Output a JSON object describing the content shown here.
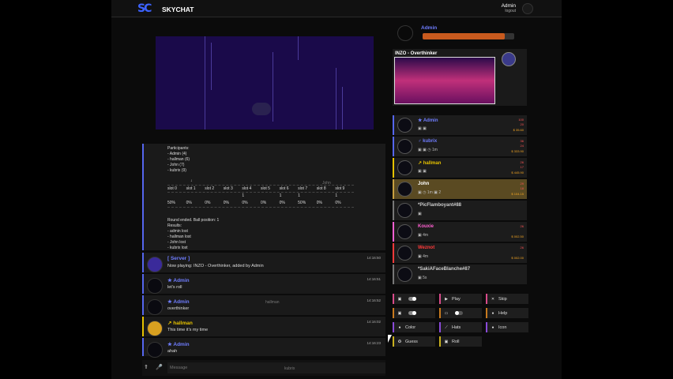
{
  "app": {
    "brand": "SKYCHAT",
    "logo": "SC"
  },
  "header": {
    "username": "Admin",
    "logout": "logout"
  },
  "sidebar_user": {
    "name": "Admin",
    "progress": 0.9
  },
  "now_playing": {
    "title": "INZO - Overthinker"
  },
  "participants": {
    "header": "Participants:",
    "list": [
      "- Admin (4)",
      "- hallman (6)",
      "- John (7)",
      "- kubrix (9)"
    ],
    "arrow": "↓",
    "slot_labels": [
      "slot 0",
      "slot 1",
      "slot 2",
      "slot 3",
      "slot 4",
      "slot 5",
      "slot 6",
      "slot 7",
      "slot 8",
      "slot 9"
    ],
    "slot_markers": [
      "",
      "",
      "",
      "",
      "1",
      "",
      "1",
      "1",
      "",
      "1"
    ],
    "slot_percents": [
      "50%",
      "0%",
      "0%",
      "0%",
      "0%",
      "0%",
      "0%",
      "50%",
      "0%",
      "0%"
    ],
    "round_result": "Round ended. Ball position: 1",
    "results_label": "Results:",
    "results": [
      "- admin lost",
      "- hallman lost",
      "- John lost",
      "- kubrix lost"
    ],
    "typing_john": "John"
  },
  "messages": [
    {
      "name": "[ Server ]",
      "text": "Now playing: INZO - Overthinker, added by Admin",
      "time": "14:16:50",
      "color": "#6f7dff"
    },
    {
      "name": "★ Admin",
      "text": "let's roll",
      "time": "14:16:51",
      "color": "#6f7dff"
    },
    {
      "name": "★ Admin",
      "text": "overthinker",
      "time": "14:16:52",
      "color": "#6f7dff",
      "typing": "hallman"
    },
    {
      "name": "↗ hallman",
      "text": "This time it's my time",
      "time": "14:16:02",
      "color": "#e6c200"
    },
    {
      "name": "★ Admin",
      "text": "ahah",
      "time": "14:16:23",
      "color": "#6f7dff"
    }
  ],
  "composer": {
    "placeholder": "Message",
    "typing": "kubrix",
    "upload_icon": "⇑",
    "mic_icon": "🎤"
  },
  "users": [
    {
      "name": "★ Admin",
      "meta": "▣ ▣",
      "r1": "100",
      "r2": "20",
      "r3": "$ 35.60",
      "color": "#6f7dff",
      "bg": "#1c1c1c",
      "border": "#5566ee"
    },
    {
      "name": "♂ kubrix",
      "meta": "▣ ▣ ◷ 1m",
      "r1": "36",
      "r2": "24",
      "r3": "$ 333.90",
      "color": "#6f7dff",
      "bg": "#1c1c1c",
      "border": "#5566ee"
    },
    {
      "name": "↗ hallman",
      "meta": "▣ ▣",
      "r1": "26",
      "r2": "17",
      "r3": "$ 445.90",
      "color": "#e6c200",
      "bg": "#1c1c1c",
      "border": "#e6c200"
    },
    {
      "name": "John",
      "meta": "▣ ◷ 1m ▣ 2",
      "r1": "29",
      "r2": "18",
      "r3": "$ 104.15",
      "color": "#ffffff",
      "bg": "#5a4a22",
      "border": "#c8a040"
    },
    {
      "name": "*PicFlamboyant#88",
      "meta": "▣",
      "r1": "",
      "r2": "",
      "r3": "",
      "color": "#cccccc",
      "bg": "#1c1c1c",
      "border": "#777777"
    },
    {
      "name": "Kouxie",
      "meta": "▣ 4m",
      "r1": "26",
      "r2": "",
      "r3": "$ 002.50",
      "color": "#ff5fd1",
      "bg": "#1c1c1c",
      "border": "#ff5fd1"
    },
    {
      "name": "Weznot",
      "meta": "▣ 4m",
      "r1": "26",
      "r2": "",
      "r3": "$ 002.00",
      "color": "#ff3a3a",
      "bg": "#1c1c1c",
      "border": "#ff3a3a"
    },
    {
      "name": "*SakiAFaceBlanche#87",
      "meta": "▣ 5s",
      "r1": "",
      "r2": "",
      "r3": "",
      "color": "#cccccc",
      "bg": "#1c1c1c",
      "border": "#777777"
    }
  ],
  "actions": [
    {
      "label": "",
      "icon": "▣",
      "toggle": "on",
      "border": "#d84a8a"
    },
    {
      "label": "Play",
      "icon": "▶",
      "border": "#d84a8a"
    },
    {
      "label": "Skip",
      "icon": "✕",
      "border": "#d84a8a"
    },
    {
      "label": "",
      "icon": "▣",
      "toggle": "on",
      "border": "#c87a1e"
    },
    {
      "label": "",
      "icon": "▭",
      "toggle": "off",
      "border": "#c87a1e"
    },
    {
      "label": "Help",
      "icon": "●",
      "border": "#c87a1e"
    },
    {
      "label": "Color",
      "icon": "●",
      "border": "#8a4ad8"
    },
    {
      "label": "Hats",
      "icon": "⟋",
      "border": "#8a4ad8"
    },
    {
      "label": "Icon",
      "icon": "●",
      "border": "#8a4ad8"
    },
    {
      "label": "Guess",
      "icon": "✪",
      "border": "#c8b01e"
    },
    {
      "label": "Roll",
      "icon": "▣",
      "border": "#c8b01e"
    }
  ]
}
